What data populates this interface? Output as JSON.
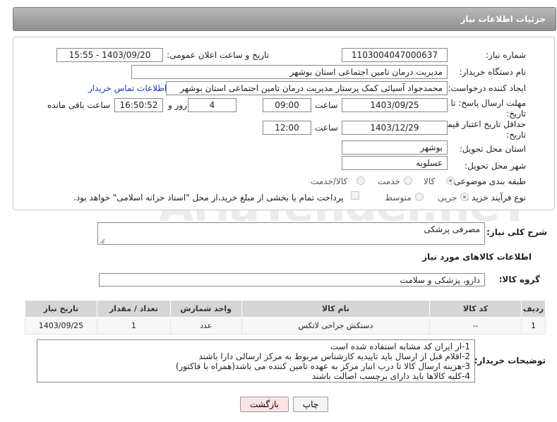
{
  "header": {
    "title": "جزئیات اطلاعات نیاز"
  },
  "form": {
    "need_number": {
      "label": "شماره نیاز:",
      "value": "1103004047000637"
    },
    "announce_datetime": {
      "label": "تاریخ و ساعت اعلان عمومی:",
      "value": "1403/09/20 - 15:55"
    },
    "buyer_org": {
      "label": "نام دستگاه خریدار:",
      "value": "مدیریت درمان تامین اجتماعی استان بوشهر"
    },
    "requester": {
      "label": "ایجاد کننده درخواست:",
      "value": "محمدجواد آسیائی کمک پرستار مدیریت درمان تامین اجتماعی استان بوشهر",
      "contact_link": "اطلاعات تماس خریدار"
    },
    "deadline": {
      "label_line1": "مهلت ارسال پاسخ: تا",
      "label_line2": "تاریخ:",
      "date": "1403/09/25",
      "time_label": "ساعت",
      "time": "09:00",
      "days": "4",
      "days_label": "روز و",
      "remaining": "16:50:52",
      "remaining_label": "ساعت باقی مانده"
    },
    "price_validity": {
      "label_line1": "حداقل تاریخ اعتبار قیمت: تا",
      "label_line2": "تاریخ:",
      "date": "1403/12/29",
      "time_label": "ساعت",
      "time": "12:00"
    },
    "province": {
      "label": "استان محل تحویل:",
      "value": "بوشهر"
    },
    "city": {
      "label": "شهر محل تحویل:",
      "value": "عسلویه"
    },
    "category": {
      "label": "طبقه بندی موضوعی:",
      "options": [
        "کالا",
        "خدمت",
        "کالا/خدمت"
      ],
      "selected": "کالا"
    },
    "purchase_type": {
      "label": "نوع فرآیند خرید :",
      "options": [
        "جزیی",
        "متوسط"
      ],
      "selected": "جزیی",
      "payment_note": "پرداخت تمام یا بخشی از مبلغ خرید،از محل \"اسناد خزانه اسلامی\" خواهد بود."
    }
  },
  "summary": {
    "label": "شرح کلی نیاز:",
    "value": "مصرفی پزشکی"
  },
  "goods_section": {
    "title": "اطلاعات کالاهای مورد نیاز"
  },
  "goods_group": {
    "label": "گروه کالا:",
    "value": "دارو، پزشکی و سلامت"
  },
  "table": {
    "headers": {
      "row": "ردیف",
      "code": "کد کالا",
      "name": "نام کالا",
      "unit": "واحد شمارش",
      "qty": "تعداد / مقدار",
      "date": "تاریخ نیاز"
    },
    "rows": [
      {
        "row": "1",
        "code": "--",
        "name": "دستکش جراحی لاتکس",
        "unit": "عدد",
        "qty": "1",
        "date": "1403/09/25"
      }
    ]
  },
  "buyer_notes": {
    "label": "توضیحات خریدار:",
    "lines": [
      "1-از ایران کد مشابه استفاده شده است",
      "2-اقلام قبل از ارسال باید تاییدیه کارشناس مربوط به  مرکز ارسالی دارا باشند",
      "3-هزینه ارسال کالا تا درب انبار مرکز به عهده تامین کننده می باشد(همراه با فاکتور)",
      "4-کلیه کالاها باید دارای برچسب اصالت باشند"
    ]
  },
  "buttons": {
    "print": "چاپ",
    "back": "بازگشت"
  },
  "colors": {
    "header_bg": "#9e9e9e",
    "back_button_bg": "#fde3e3",
    "link": "#1a3faa"
  },
  "watermark": {
    "text": "AriaTender.neT"
  }
}
